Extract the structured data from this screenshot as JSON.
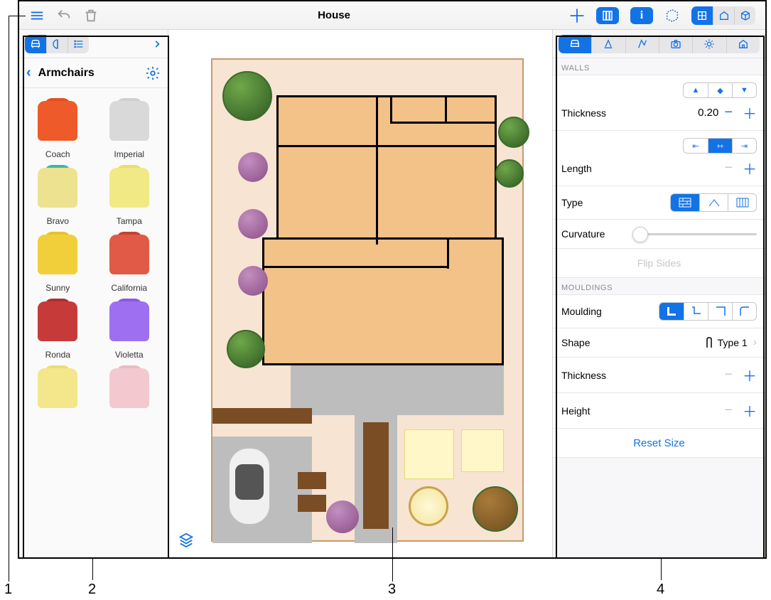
{
  "header": {
    "title": "House"
  },
  "library": {
    "category": "Armchairs",
    "items": [
      {
        "label": "Coach",
        "color": "#ef5a2a",
        "back": "#e2501f"
      },
      {
        "label": "Imperial",
        "color": "#d9d9d9",
        "back": "#cfcfcf"
      },
      {
        "label": "Bravo",
        "color": "#ece290",
        "back": "#3fb6a6"
      },
      {
        "label": "Tampa",
        "color": "#f0e986",
        "back": "#e9df6e"
      },
      {
        "label": "Sunny",
        "color": "#f1cf3b",
        "back": "#e7c22e"
      },
      {
        "label": "California",
        "color": "#e05a47",
        "back": "#c34231"
      },
      {
        "label": "Ronda",
        "color": "#c63a3a",
        "back": "#b12f2f"
      },
      {
        "label": "Violetta",
        "color": "#9e6ff0",
        "back": "#8a5ae0"
      },
      {
        "label": "",
        "color": "#f4e68a",
        "back": "#eedb72"
      },
      {
        "label": "",
        "color": "#f3c9cf",
        "back": "#eebac1"
      }
    ]
  },
  "inspector": {
    "walls_header": "WALLS",
    "thickness_label": "Thickness",
    "thickness_value": "0.20",
    "length_label": "Length",
    "type_label": "Type",
    "curvature_label": "Curvature",
    "flip_label": "Flip Sides",
    "mouldings_header": "MOULDINGS",
    "moulding_label": "Moulding",
    "shape_label": "Shape",
    "shape_value": "Type 1",
    "m_thickness_label": "Thickness",
    "height_label": "Height",
    "reset_label": "Reset Size"
  },
  "callouts": {
    "n1": "1",
    "n2": "2",
    "n3": "3",
    "n4": "4"
  }
}
